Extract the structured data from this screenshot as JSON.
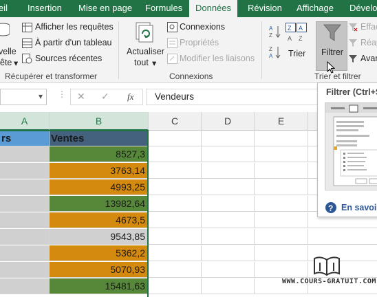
{
  "ribbon_tabs": [
    "eil",
    "Insertion",
    "Mise en page",
    "Formules",
    "Données",
    "Révision",
    "Affichage",
    "Dévelop"
  ],
  "active_tab": "Données",
  "colors": {
    "accent": "#217346",
    "orange": "#d4890f",
    "green": "#57883a",
    "gray": "#d0d0d0",
    "header_blue": "#5b9bd5",
    "header_dark": "#44627e"
  },
  "groups": {
    "recuperer": {
      "label": "Récupérer et transformer",
      "new_query_line1": "velle",
      "new_query_line2": "ête",
      "show_queries": "Afficher les requêtes",
      "from_table": "À partir d'un tableau",
      "recent_sources": "Sources récentes"
    },
    "connexions": {
      "label": "Connexions",
      "refresh_line1": "Actualiser",
      "refresh_line2": "tout",
      "connections": "Connexions",
      "properties": "Propriétés",
      "edit_links": "Modifier les liaisons"
    },
    "trier": {
      "label": "Trier et filtrer",
      "sort": "Trier",
      "filter": "Filtrer",
      "clear": "Effac",
      "reapply": "Réap",
      "advanced": "Avar"
    }
  },
  "formula_bar": {
    "cancel": "✕",
    "enter": "✓",
    "fx": "fx",
    "content": "Vendeurs"
  },
  "columns": [
    "A",
    "B",
    "C",
    "D",
    "E"
  ],
  "sheet": {
    "a_header": "rs",
    "b_header": "Ventes",
    "rows": [
      {
        "value": "8527,3",
        "color": "green"
      },
      {
        "value": "3763,14",
        "color": "orange"
      },
      {
        "value": "4993,25",
        "color": "orange"
      },
      {
        "value": "13982,64",
        "color": "green"
      },
      {
        "value": "4673,5",
        "color": "orange"
      },
      {
        "value": "9543,85",
        "color": "gray"
      },
      {
        "value": "5362,2",
        "color": "orange"
      },
      {
        "value": "5070,93",
        "color": "orange"
      },
      {
        "value": "15481,63",
        "color": "green"
      }
    ]
  },
  "tooltip": {
    "title": "Filtrer (Ctrl+S",
    "learn_more": "En savoir"
  },
  "watermark": "WWW.COURS-GRATUIT.COM"
}
